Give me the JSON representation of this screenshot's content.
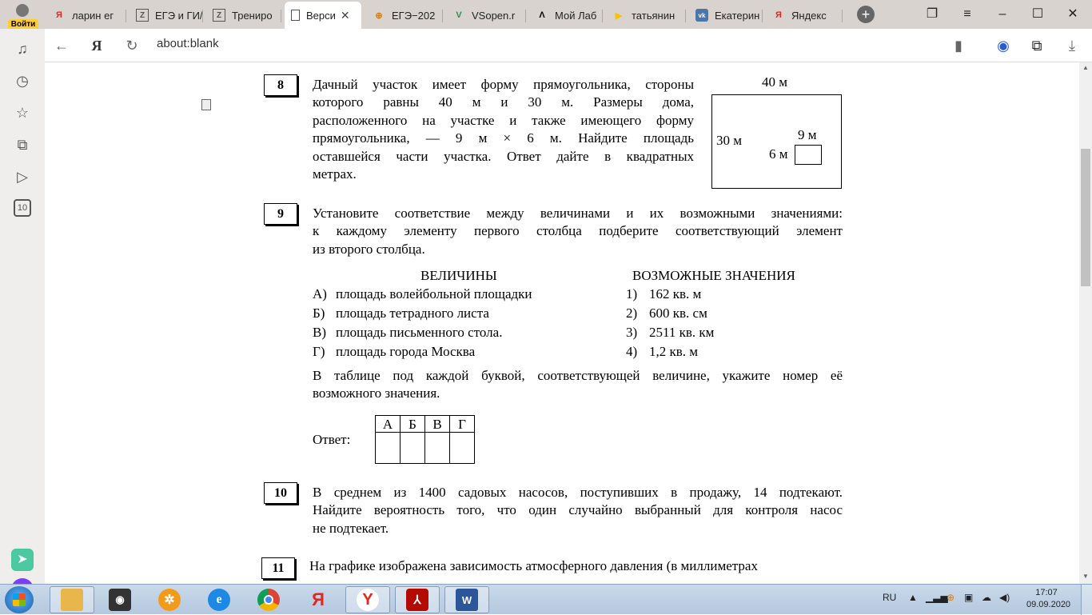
{
  "browser": {
    "login_label": "Войти",
    "tabs": [
      {
        "label": "ларин ег",
        "icon": "Я",
        "icon_color": "#e52620"
      },
      {
        "label": "ЕГЭ и ГИ/",
        "icon": "Z",
        "icon_color": "#555555"
      },
      {
        "label": "Трениро",
        "icon": "Z",
        "icon_color": "#555555"
      },
      {
        "label": "Верси",
        "icon": "doc",
        "icon_color": "#555555",
        "active": true
      },
      {
        "label": "ЕГЭ−202",
        "icon": "⊕",
        "icon_color": "#e07b00"
      },
      {
        "label": "VSopen.r",
        "icon": "V",
        "icon_color": "#2e8b57"
      },
      {
        "label": "Мой Лаб",
        "icon": "Λ",
        "icon_color": "#000000"
      },
      {
        "label": "татьянин",
        "icon": "▶",
        "icon_color": "#f5c400"
      },
      {
        "label": "Екатерин",
        "icon": "vk",
        "icon_color": "#4a76a8"
      },
      {
        "label": "Яндекс",
        "icon": "Я",
        "icon_color": "#e52620"
      }
    ],
    "url": "about:blank"
  },
  "doc": {
    "q8": {
      "num": "8",
      "lines": [
        "Дачный участок имеет форму прямоугольника, стороны",
        "которого равны 40 м и 30 м. Размеры дома,",
        "расположенного на участке и также имеющего форму",
        "прямоугольника, — 9 м × 6 м. Найдите площадь",
        "оставшейся части участка. Ответ дайте в квадратных",
        "метрах."
      ],
      "fig_top": "40 м",
      "fig_left": "30 м",
      "fig_house_w": "9 м",
      "fig_house_h": "6 м"
    },
    "q9": {
      "num": "9",
      "lines": [
        "Установите соответствие между величинами и их возможными значениями:",
        "к каждому элементу первого столбца подберите соответствующий элемент",
        "из второго столбца."
      ],
      "col1_header": "ВЕЛИЧИНЫ",
      "col2_header": "ВОЗМОЖНЫЕ ЗНАЧЕНИЯ",
      "items": [
        {
          "letter": "А)",
          "text": "площадь волейбольной площадки"
        },
        {
          "letter": "Б)",
          "text": "площадь тетрадного листа"
        },
        {
          "letter": "В)",
          "text": "площадь письменного стола."
        },
        {
          "letter": "Г)",
          "text": "площадь города Москва"
        }
      ],
      "values": [
        {
          "num": "1)",
          "text": "162 кв. м"
        },
        {
          "num": "2)",
          "text": "600 кв. см"
        },
        {
          "num": "3)",
          "text": "2511 кв. км"
        },
        {
          "num": "4)",
          "text": "1,2 кв. м"
        }
      ],
      "instruction_lines": [
        "В таблице под каждой буквой, соответствующей величине, укажите номер её",
        "возможного значения."
      ],
      "answer_label": "Ответ:",
      "table_headers": [
        "А",
        "Б",
        "В",
        "Г"
      ]
    },
    "q10": {
      "num": "10",
      "lines": [
        "В среднем из 1400 садовых насосов, поступивших в продажу, 14 подтекают.",
        "Найдите вероятность того, что один случайно выбранный для контроля насос",
        "не подтекает."
      ]
    },
    "q11": {
      "num": "11",
      "line": "На графике изображена зависимость атмосферного давления (в миллиметрах"
    }
  },
  "taskbar": {
    "lang": "RU",
    "time": "17:07",
    "date": "09.09.2020"
  }
}
